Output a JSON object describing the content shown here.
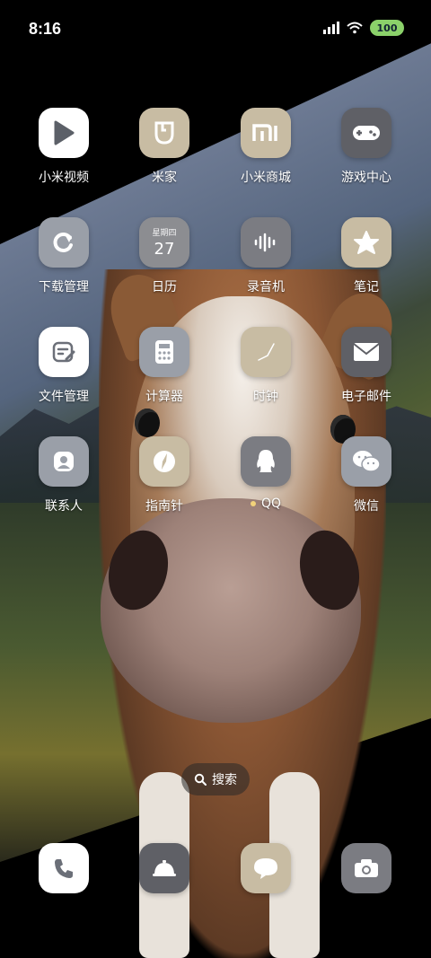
{
  "status_bar": {
    "time": "8:16",
    "battery": "100"
  },
  "colors": {
    "white": "#ffffff",
    "beige": "#c8bca3",
    "gray": "#9a9fa8",
    "dark_gray": "#5f6066",
    "accent_green": "#8bd16a"
  },
  "apps": [
    {
      "label": "小米视频",
      "icon": "play-icon"
    },
    {
      "label": "米家",
      "icon": "mijia-icon"
    },
    {
      "label": "小米商城",
      "icon": "mi-logo-icon"
    },
    {
      "label": "游戏中心",
      "icon": "gamepad-icon"
    },
    {
      "label": "下载管理",
      "icon": "refresh-icon"
    },
    {
      "label": "日历",
      "icon": "calendar-icon",
      "weekday": "星期四",
      "day": "27"
    },
    {
      "label": "录音机",
      "icon": "waveform-icon"
    },
    {
      "label": "笔记",
      "icon": "star-icon"
    },
    {
      "label": "文件管理",
      "icon": "document-icon"
    },
    {
      "label": "计算器",
      "icon": "calculator-icon"
    },
    {
      "label": "时钟",
      "icon": "clock-icon"
    },
    {
      "label": "电子邮件",
      "icon": "mail-icon"
    },
    {
      "label": "联系人",
      "icon": "contact-icon"
    },
    {
      "label": "指南针",
      "icon": "compass-icon"
    },
    {
      "label": "QQ",
      "icon": "qq-penguin-icon"
    },
    {
      "label": "微信",
      "icon": "wechat-icon"
    }
  ],
  "search": {
    "label": "搜索"
  },
  "dock": [
    {
      "icon": "phone-icon"
    },
    {
      "icon": "bell-icon"
    },
    {
      "icon": "message-icon"
    },
    {
      "icon": "camera-icon"
    }
  ]
}
